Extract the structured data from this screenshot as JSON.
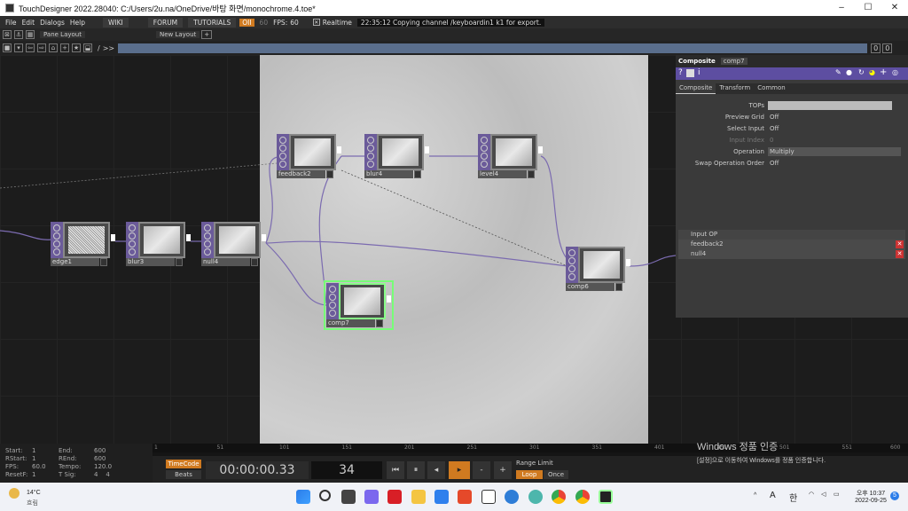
{
  "window": {
    "title": "TouchDesigner 2022.28040: C:/Users/2u.na/OneDrive/바탕 화면/monochrome.4.toe*",
    "minimize": "–",
    "maximize": "☐",
    "close": "✕"
  },
  "menu": {
    "items": [
      "File",
      "Edit",
      "Dialogs",
      "Help"
    ],
    "wiki": "WIKI",
    "forum": "FORUM",
    "tutorials": "TUTORIALS",
    "oii": "OII",
    "fps_cook": "60",
    "fps_label": "FPS:",
    "fps_value": "60",
    "realtime": "Realtime",
    "status": "22:35:12 Copying channel /keyboardin1 k1 for export."
  },
  "toolbar": {
    "pane_layout": "Pane Layout",
    "new_layout": "New Layout",
    "add": "+"
  },
  "path": {
    "root": "/",
    "sep": ">>",
    "counter1": "0",
    "counter2": "0"
  },
  "nodes": [
    {
      "id": "edge1",
      "label": "edge1"
    },
    {
      "id": "blur3",
      "label": "blur3"
    },
    {
      "id": "null4",
      "label": "null4"
    },
    {
      "id": "feedback2",
      "label": "feedback2"
    },
    {
      "id": "blur4",
      "label": "blur4"
    },
    {
      "id": "level4",
      "label": "level4"
    },
    {
      "id": "comp6",
      "label": "comp6"
    },
    {
      "id": "comp7",
      "label": "comp7"
    }
  ],
  "param": {
    "type": "Composite",
    "name": "comp7",
    "tabs": [
      "Composite",
      "Transform",
      "Common"
    ],
    "rows": [
      {
        "label": "TOPs",
        "value": ""
      },
      {
        "label": "Preview Grid",
        "value": "Off"
      },
      {
        "label": "Select Input",
        "value": "Off"
      },
      {
        "label": "Input Index",
        "value": "0"
      },
      {
        "label": "Operation",
        "value": "Multiply"
      },
      {
        "label": "Swap Operation Order",
        "value": "Off"
      }
    ],
    "input_header": "Input OP",
    "inputs": [
      "feedback2",
      "null4"
    ]
  },
  "stats": {
    "start_l": "Start:",
    "start": "1",
    "rstart_l": "RStart:",
    "rstart": "1",
    "fps_l": "FPS:",
    "fps": "60.0",
    "resetf_l": "ResetF:",
    "resetf": "1",
    "end_l": "End:",
    "end": "600",
    "rend_l": "REnd:",
    "rend": "600",
    "tempo_l": "Tempo:",
    "tempo": "120.0",
    "tsig_l": "T Sig:",
    "tsig1": "4",
    "tsig2": "4"
  },
  "ruler": [
    "1",
    "51",
    "101",
    "151",
    "201",
    "251",
    "301",
    "351",
    "401",
    "451",
    "501",
    "551",
    "600"
  ],
  "transport": {
    "timecode": "TimeCode",
    "beats": "Beats",
    "time": "00:00:00.33",
    "frame": "34",
    "range_limit": "Range Limit",
    "loop": "Loop",
    "once": "Once",
    "minus": "-",
    "plus": "+"
  },
  "watermark": {
    "line1": "Windows 정품 인증",
    "line2": "[설정]으로 이동하여 Windows를 정품 인증합니다."
  },
  "taskbar": {
    "temp": "14°C",
    "weather": "흐림",
    "time": "오후 10:37",
    "date": "2022-09-25",
    "ime": "한",
    "lang": "A",
    "badge": "5"
  },
  "colors": {
    "node": "#6b5b9a",
    "selected": "#7fff7f",
    "accent": "#d07a20"
  }
}
